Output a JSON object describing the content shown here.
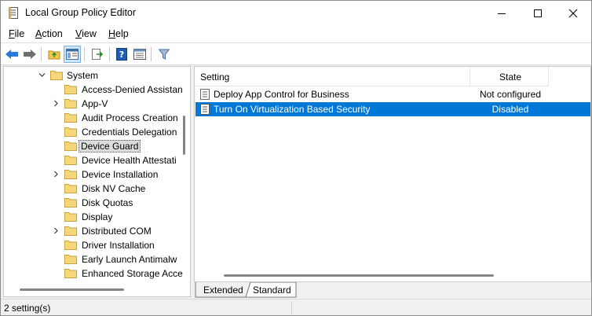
{
  "window": {
    "title": "Local Group Policy Editor",
    "icon": "document-policy-icon"
  },
  "menubar": {
    "items": [
      {
        "label": "File",
        "accel": "F",
        "rest": "ile"
      },
      {
        "label": "Action",
        "accel": "A",
        "rest": "ction"
      },
      {
        "label": "View",
        "accel": "V",
        "rest": "iew"
      },
      {
        "label": "Help",
        "accel": "H",
        "rest": "elp"
      }
    ]
  },
  "toolbar": {
    "buttons": [
      "back-icon",
      "forward-icon",
      "up-folder-icon",
      "show-hide-tree-icon",
      "export-list-icon",
      "help-icon",
      "properties-view-icon",
      "filter-icon"
    ]
  },
  "tree": {
    "items": [
      {
        "label": "System",
        "expanded": true
      },
      {
        "label": "Access-Denied Assistan",
        "expandable": false
      },
      {
        "label": "App-V",
        "expandable": true
      },
      {
        "label": "Audit Process Creation",
        "expandable": false
      },
      {
        "label": "Credentials Delegation",
        "expandable": false
      },
      {
        "label": "Device Guard",
        "expandable": false,
        "selected": true
      },
      {
        "label": "Device Health Attestati",
        "expandable": false
      },
      {
        "label": "Device Installation",
        "expandable": true
      },
      {
        "label": "Disk NV Cache",
        "expandable": false
      },
      {
        "label": "Disk Quotas",
        "expandable": false
      },
      {
        "label": "Display",
        "expandable": false
      },
      {
        "label": "Distributed COM",
        "expandable": true
      },
      {
        "label": "Driver Installation",
        "expandable": false
      },
      {
        "label": "Early Launch Antimalw",
        "expandable": false
      },
      {
        "label": "Enhanced Storage Acce",
        "expandable": false
      }
    ]
  },
  "list": {
    "columns": {
      "setting": "Setting",
      "state": "State"
    },
    "rows": [
      {
        "name": "Deploy App Control for Business",
        "state": "Not configured",
        "selected": false
      },
      {
        "name": "Turn On Virtualization Based Security",
        "state": "Disabled",
        "selected": true
      }
    ]
  },
  "tabs": {
    "extended": "Extended",
    "standard": "Standard",
    "active": "Standard"
  },
  "status": {
    "text": "2 setting(s)"
  },
  "colors": {
    "selection": "#0078d7",
    "folder": "#f6d77a",
    "accent_icon": "#1e6fc4"
  }
}
